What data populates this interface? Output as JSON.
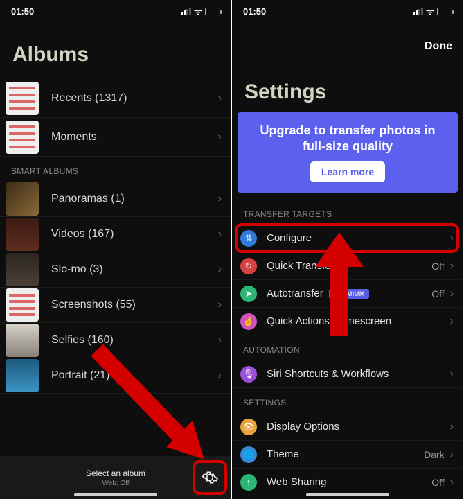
{
  "status": {
    "time": "01:50"
  },
  "left": {
    "title": "Albums",
    "albums": [
      {
        "label": "Recents (1317)"
      },
      {
        "label": "Moments"
      }
    ],
    "smart_header": "SMART ALBUMS",
    "smart": [
      {
        "label": "Panoramas (1)"
      },
      {
        "label": "Videos (167)"
      },
      {
        "label": "Slo-mo (3)"
      },
      {
        "label": "Screenshots (55)"
      },
      {
        "label": "Selfies (160)"
      },
      {
        "label": "Portrait (21)"
      }
    ],
    "bottom": {
      "title": "Select an album",
      "subtitle": "Web: Off"
    }
  },
  "right": {
    "done": "Done",
    "title": "Settings",
    "banner": {
      "text": "Upgrade to transfer photos in full-size quality",
      "cta": "Learn more"
    },
    "sections": {
      "transfer_header": "TRANSFER TARGETS",
      "transfer": [
        {
          "label": "Configure",
          "value": "",
          "icon": "#2f7bd6",
          "glyph": "⇅",
          "hl": true
        },
        {
          "label": "Quick Transfer",
          "value": "Off",
          "icon": "#d44143",
          "glyph": "↻"
        },
        {
          "label": "Autotransfer",
          "value": "Off",
          "icon": "#2bb673",
          "glyph": "➤",
          "premium": "PREMIUM"
        },
        {
          "label": "Quick Actions Homescreen",
          "value": "",
          "icon": "#d24fbf",
          "glyph": "☝"
        }
      ],
      "automation_header": "AUTOMATION",
      "automation": [
        {
          "label": "Siri Shortcuts & Workflows",
          "icon": "#9b4fd6",
          "glyph": "🎙"
        }
      ],
      "settings_header": "SETTINGS",
      "settings": [
        {
          "label": "Display Options",
          "icon": "#e8a33c",
          "glyph": "👁"
        },
        {
          "label": "Theme",
          "value": "Dark",
          "icon": "#3a87d6",
          "glyph": "🌐"
        },
        {
          "label": "Web Sharing",
          "value": "Off",
          "icon": "#2bb673",
          "glyph": "↑"
        }
      ]
    }
  }
}
